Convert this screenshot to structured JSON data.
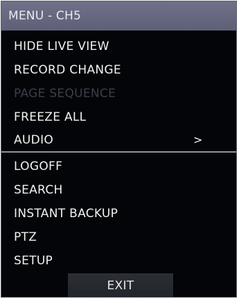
{
  "menu": {
    "title": "MENU - CH5",
    "items": [
      {
        "label": "HIDE LIVE VIEW",
        "enabled": true
      },
      {
        "label": "RECORD CHANGE",
        "enabled": true
      },
      {
        "label": "PAGE SEQUENCE",
        "enabled": false
      },
      {
        "label": "FREEZE ALL",
        "enabled": true
      },
      {
        "label": "AUDIO",
        "enabled": true,
        "submenu_indicator": ">"
      },
      {
        "label": "LOGOFF",
        "enabled": true
      },
      {
        "label": "SEARCH",
        "enabled": true
      },
      {
        "label": "INSTANT BACKUP",
        "enabled": true
      },
      {
        "label": "PTZ",
        "enabled": true
      },
      {
        "label": "SETUP",
        "enabled": true
      }
    ],
    "exit_label": "EXIT"
  },
  "colors": {
    "header_background": "#666880",
    "menu_background": "#030508",
    "text": "#f2f2f2",
    "disabled_text": "#3c3f4a",
    "divider": "#8e92a3",
    "exit_button_background": "#2a2c34"
  }
}
